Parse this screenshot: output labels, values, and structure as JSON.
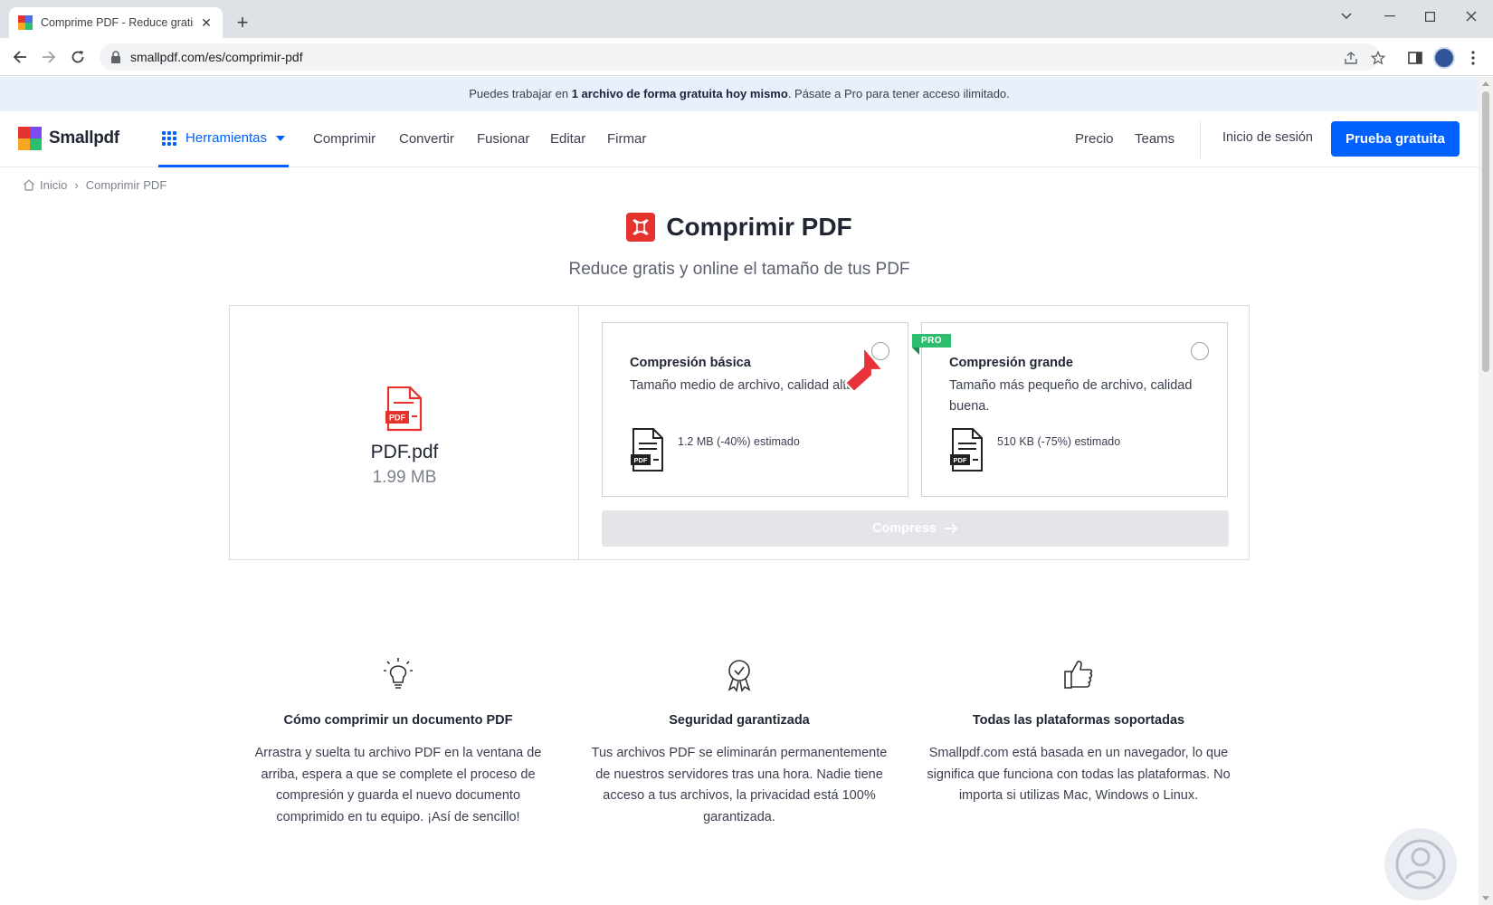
{
  "browser": {
    "tab_title": "Comprime PDF - Reduce gratis y",
    "url": "smallpdf.com/es/comprimir-pdf"
  },
  "promo": {
    "prefix": "Puedes trabajar en ",
    "bold": "1 archivo de forma gratuita hoy mismo",
    "suffix": ". Pásate a Pro para tener acceso ilimitado."
  },
  "header": {
    "logo": "Smallpdf",
    "tools_label": "Herramientas",
    "nav": [
      "Comprimir",
      "Convertir",
      "Fusionar",
      "Editar",
      "Firmar"
    ],
    "right_nav": [
      "Precio",
      "Teams"
    ],
    "login": "Inicio de sesión",
    "cta": "Prueba gratuita"
  },
  "breadcrumb": {
    "home": "Inicio",
    "current": "Comprimir PDF"
  },
  "hero": {
    "title": "Comprimir PDF",
    "subtitle": "Reduce gratis y online el tamaño de tus PDF"
  },
  "file": {
    "name": "PDF.pdf",
    "size": "1.99 MB",
    "icon_label": "PDF"
  },
  "options": [
    {
      "title": "Compresión básica",
      "desc": "Tamaño medio de archivo, calidad alta",
      "estimate": "1.2 MB (-40%) estimado",
      "pro": false
    },
    {
      "title": "Compresión grande",
      "desc": "Tamaño más pequeño de archivo, calidad buena.",
      "estimate": "510 KB (-75%) estimado",
      "pro": true,
      "badge": "PRO"
    }
  ],
  "compress_button": "Compress",
  "features": [
    {
      "icon": "lightbulb-icon",
      "title": "Cómo comprimir un documento PDF",
      "text": "Arrastra y suelta tu archivo PDF en la ventana de arriba, espera a que se complete el proceso de compresión y guarda el nuevo documento comprimido en tu equipo. ¡Así de sencillo!"
    },
    {
      "icon": "award-icon",
      "title": "Seguridad garantizada",
      "text": "Tus archivos PDF se eliminarán permanentemente de nuestros servidores tras una hora. Nadie tiene acceso a tus archivos, la privacidad está 100% garantizada."
    },
    {
      "icon": "thumbs-up-icon",
      "title": "Todas las plataformas soportadas",
      "text": "Smallpdf.com está basada en un navegador, lo que significa que funciona con todas las plataformas. No importa si utilizas Mac, Windows o Linux."
    }
  ],
  "colors": {
    "brand_blue": "#0061fe",
    "pdf_red": "#e5322d",
    "pro_green": "#2dbd6e"
  }
}
